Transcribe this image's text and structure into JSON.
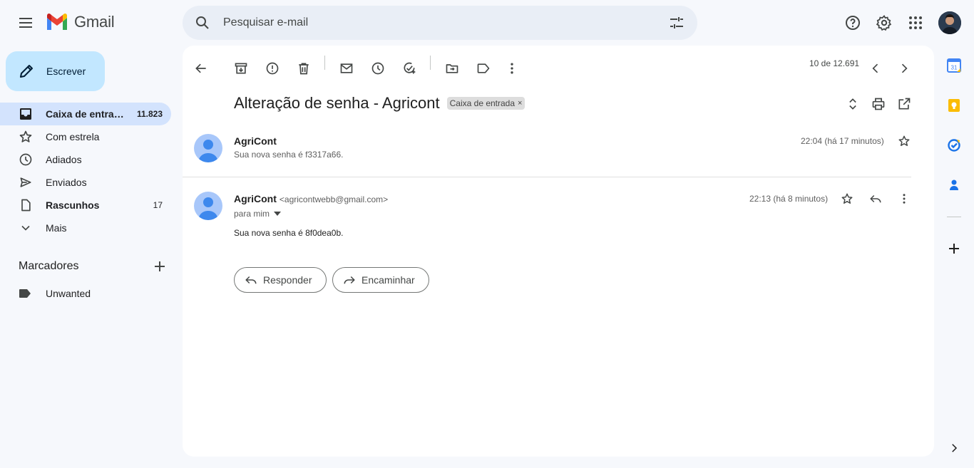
{
  "app": {
    "logo_text": "Gmail"
  },
  "search": {
    "placeholder": "Pesquisar e-mail"
  },
  "sidebar": {
    "compose_label": "Escrever",
    "items": [
      {
        "label": "Caixa de entrada",
        "count": "11.823",
        "icon": "inbox-icon",
        "active": true
      },
      {
        "label": "Com estrela",
        "count": "",
        "icon": "star-icon"
      },
      {
        "label": "Adiados",
        "count": "",
        "icon": "clock-icon"
      },
      {
        "label": "Enviados",
        "count": "",
        "icon": "send-icon"
      },
      {
        "label": "Rascunhos",
        "count": "17",
        "icon": "draft-icon"
      },
      {
        "label": "Mais",
        "count": "",
        "icon": "chevron-down-icon"
      }
    ],
    "labels_heading": "Marcadores",
    "labels": [
      {
        "label": "Unwanted",
        "icon": "label-icon"
      }
    ]
  },
  "toolbar": {
    "pager_text": "10 de 12.691"
  },
  "thread": {
    "subject": "Alteração de senha - Agricont",
    "tag": "Caixa de entrada",
    "messages": [
      {
        "sender": "AgriCont",
        "snippet": "Sua nova senha é f3317a66.",
        "time": "22:04 (há 17 minutos)"
      },
      {
        "sender": "AgriCont",
        "email": "<agricontwebb@gmail.com>",
        "to": "para mim",
        "time": "22:13 (há 8 minutos)",
        "body": "Sua nova senha é 8f0dea0b."
      }
    ],
    "reply_label": "Responder",
    "forward_label": "Encaminhar"
  },
  "colors": {
    "background": "#f6f8fc",
    "compose": "#c2e7ff",
    "active_nav": "#d3e3fd",
    "search": "#e9eef6"
  }
}
